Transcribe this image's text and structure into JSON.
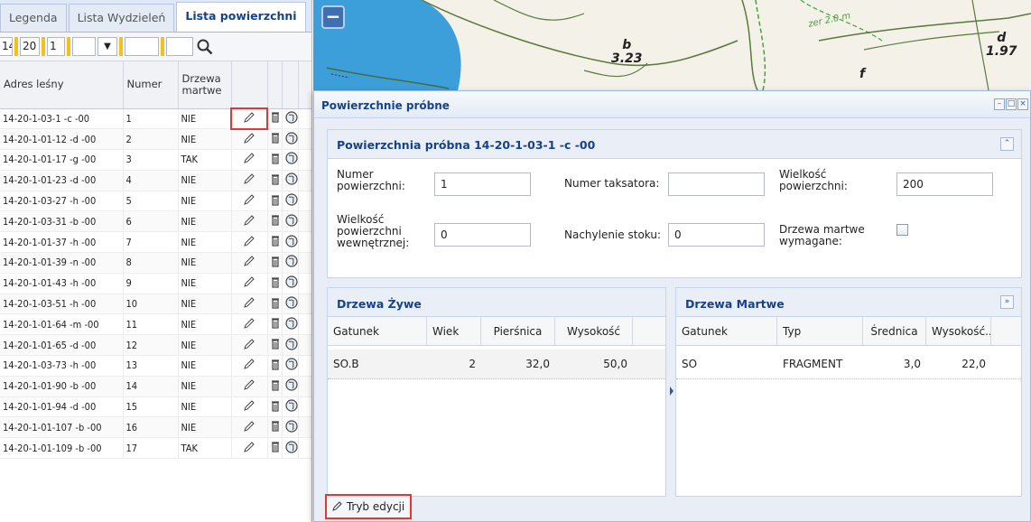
{
  "left_panel": {
    "tabs": [
      {
        "label": "Legenda",
        "active": false
      },
      {
        "label": "Lista Wydzieleń",
        "active": false
      },
      {
        "label": "Lista powierzchni",
        "active": true
      }
    ],
    "filters": [
      "14",
      "20",
      "1",
      "",
      ""
    ],
    "search_icon": "search-icon",
    "columns": {
      "address": "Adres leśny",
      "number": "Numer",
      "dead_trees": "Drzewa martwe"
    },
    "rows": [
      {
        "address": "14-20-1-03-1 -c -00",
        "number": "1",
        "dead": "NIE"
      },
      {
        "address": "14-20-1-01-12 -d -00",
        "number": "2",
        "dead": "NIE"
      },
      {
        "address": "14-20-1-01-17 -g -00",
        "number": "3",
        "dead": "TAK"
      },
      {
        "address": "14-20-1-01-23 -d -00",
        "number": "4",
        "dead": "NIE"
      },
      {
        "address": "14-20-1-03-27 -h -00",
        "number": "5",
        "dead": "NIE"
      },
      {
        "address": "14-20-1-03-31 -b -00",
        "number": "6",
        "dead": "NIE"
      },
      {
        "address": "14-20-1-01-37 -h -00",
        "number": "7",
        "dead": "NIE"
      },
      {
        "address": "14-20-1-01-39 -n -00",
        "number": "8",
        "dead": "NIE"
      },
      {
        "address": "14-20-1-01-43 -h -00",
        "number": "9",
        "dead": "NIE"
      },
      {
        "address": "14-20-1-03-51 -h -00",
        "number": "10",
        "dead": "NIE"
      },
      {
        "address": "14-20-1-01-64 -m -00",
        "number": "11",
        "dead": "NIE"
      },
      {
        "address": "14-20-1-01-65 -d -00",
        "number": "12",
        "dead": "NIE"
      },
      {
        "address": "14-20-1-03-73 -h -00",
        "number": "13",
        "dead": "NIE"
      },
      {
        "address": "14-20-1-01-90 -b -00",
        "number": "14",
        "dead": "NIE"
      },
      {
        "address": "14-20-1-01-94 -d -00",
        "number": "15",
        "dead": "NIE"
      },
      {
        "address": "14-20-1-01-107 -b -00",
        "number": "16",
        "dead": "NIE"
      },
      {
        "address": "14-20-1-01-109 -b -00",
        "number": "17",
        "dead": "TAK"
      }
    ]
  },
  "map": {
    "labels": [
      {
        "name": "b",
        "value": "3.23"
      },
      {
        "name": "d",
        "value": "1.97"
      },
      {
        "name": "f",
        "value": ""
      }
    ],
    "contour_label": "zer 2.0 m",
    "zoom_out": "−",
    "water_color": "#3d9fd9"
  },
  "dialog": {
    "title": "Powierzchnie próbne",
    "panel_title": "Powierzchnia próbna 14-20-1-03-1 -c -00",
    "fields": {
      "numer_label": "Numer powierzchni:",
      "numer_value": "1",
      "taksator_label": "Numer taksatora:",
      "taksator_value": "",
      "wielkosc_label": "Wielkość powierzchni:",
      "wielkosc_value": "200",
      "wewn_label": "Wielkość powierzchni wewnętrznej:",
      "wewn_value": "0",
      "nachylenie_label": "Nachylenie stoku:",
      "nachylenie_value": "0",
      "martwe_label": "Drzewa martwe wymagane:",
      "martwe_checked": false
    },
    "live": {
      "title": "Drzewa Żywe",
      "columns": [
        "Gatunek",
        "Wiek",
        "Pierśnica",
        "Wysokość"
      ],
      "rows": [
        {
          "gatunek": "SO.B",
          "wiek": "2",
          "piersnica": "32,0",
          "wysokosc": "50,0"
        }
      ]
    },
    "dead": {
      "title": "Drzewa Martwe",
      "columns": [
        "Gatunek",
        "Typ",
        "Średnica",
        "Wysokość..."
      ],
      "rows": [
        {
          "gatunek": "SO",
          "typ": "FRAGMENT",
          "srednica": "3,0",
          "wysokosc": "22,0"
        }
      ]
    },
    "edit_button": "Tryb edycji"
  },
  "colors": {
    "accent": "#15428b",
    "highlight": "#e53535",
    "filter_separator": "#f2c21b"
  }
}
